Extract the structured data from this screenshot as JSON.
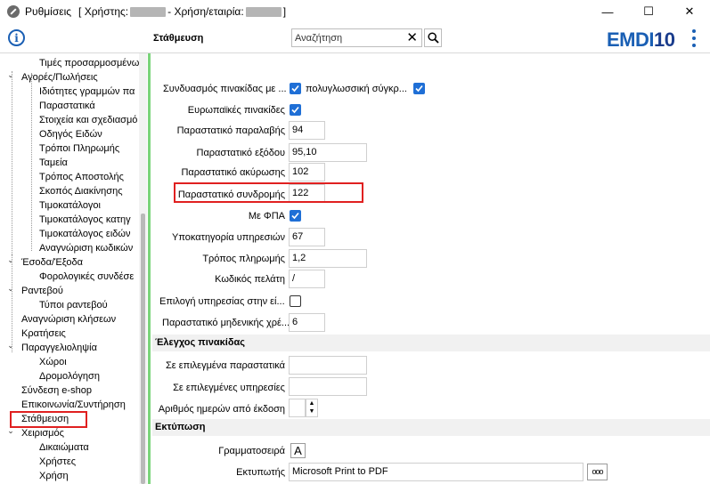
{
  "window": {
    "title_prefix": "Ρυθμίσεις",
    "title_user_label": "[ Χρήστης:",
    "title_company_label": "- Χρήση/εταιρία:",
    "title_suffix": "]",
    "minimize": "—",
    "maximize": "☐",
    "close": "✕"
  },
  "header": {
    "page_title": "Στάθμευση",
    "search_placeholder": "Αναζήτηση",
    "logo_part1": "EMDI",
    "logo_part2": "10",
    "info_glyph": "i"
  },
  "sidebar": {
    "items": [
      {
        "label": "Τιμές προσαρμοσμένω",
        "level": 2
      },
      {
        "label": "Αγορές/Πωλήσεις",
        "level": 1,
        "toggle": "⌄"
      },
      {
        "label": "Ιδιότητες γραμμών πα",
        "level": 2
      },
      {
        "label": "Παραστατικά",
        "level": 2
      },
      {
        "label": "Στοιχεία και σχεδιασμό",
        "level": 2
      },
      {
        "label": "Οδηγός Ειδών",
        "level": 2
      },
      {
        "label": "Τρόποι Πληρωμής",
        "level": 2
      },
      {
        "label": "Ταμεία",
        "level": 2
      },
      {
        "label": "Τρόπος Αποστολής",
        "level": 2
      },
      {
        "label": "Σκοπός Διακίνησης",
        "level": 2
      },
      {
        "label": "Τιμοκατάλογοι",
        "level": 2
      },
      {
        "label": "Τιμοκατάλογος κατηγ",
        "level": 2
      },
      {
        "label": "Τιμοκατάλογος ειδών",
        "level": 2
      },
      {
        "label": "Αναγνώριση κωδικών",
        "level": 2
      },
      {
        "label": "Έσοδα/Έξοδα",
        "level": 1,
        "toggle": "⌄"
      },
      {
        "label": "Φορολογικές συνδέσε",
        "level": 2
      },
      {
        "label": "Ραντεβού",
        "level": 1,
        "toggle": "⌄"
      },
      {
        "label": "Τύποι ραντεβού",
        "level": 2
      },
      {
        "label": "Αναγνώριση κλήσεων",
        "level": 1
      },
      {
        "label": "Κρατήσεις",
        "level": 1
      },
      {
        "label": "Παραγγελιοληψία",
        "level": 1,
        "toggle": "⌄"
      },
      {
        "label": "Χώροι",
        "level": 2
      },
      {
        "label": "Δρομολόγηση",
        "level": 2
      },
      {
        "label": "Σύνδεση e-shop",
        "level": 1
      },
      {
        "label": "Επικοινωνία/Συντήρηση",
        "level": 1
      },
      {
        "label": "Στάθμευση",
        "level": 1,
        "selected": true
      },
      {
        "label": "Χειρισμός",
        "level": 1,
        "toggle": "⌄"
      },
      {
        "label": "Δικαιώματα",
        "level": 2
      },
      {
        "label": "Χρήστες",
        "level": 2
      },
      {
        "label": "Χρήση",
        "level": 2
      }
    ]
  },
  "form": {
    "plate_combo_label": "Συνδυασμός πινακίδας με ...",
    "multilingual_label": "πολυγλωσσική σύγκρ...",
    "european_plates_label": "Ευρωπαϊκές πινακίδες",
    "receipt_doc_label": "Παραστατικό παραλαβής",
    "receipt_doc_value": "94",
    "exit_doc_label": "Παραστατικό εξόδου",
    "exit_doc_value": "95,10",
    "cancel_doc_label": "Παραστατικό ακύρωσης",
    "cancel_doc_value": "102",
    "subscription_doc_label": "Παραστατικό συνδρομής",
    "subscription_doc_value": "122",
    "vat_label": "Με ΦΠΑ",
    "service_subcat_label": "Υποκατηγορία υπηρεσιών",
    "service_subcat_value": "67",
    "payment_method_label": "Τρόπος πληρωμής",
    "payment_method_value": "1,2",
    "customer_code_label": "Κωδικός πελάτη",
    "customer_code_value": "/",
    "service_select_label": "Επιλογή υπηρεσίας στην εί...",
    "zero_doc_label": "Παραστατικό μηδενικής χρέ...",
    "zero_doc_value": "6",
    "plate_check_section": "Έλεγχος πινακίδας",
    "selected_docs_label": "Σε επιλεγμένα παραστατικά",
    "selected_services_label": "Σε επιλεγμένες υπηρεσίες",
    "days_from_issue_label": "Αριθμός ημερών από έκδοση",
    "print_section": "Εκτύπωση",
    "font_label": "Γραμματοσειρά",
    "font_button": "A",
    "printer_label": "Εκτυπωτής",
    "printer_value": "Microsoft Print to PDF",
    "printer_browse": "ooo"
  },
  "colors": {
    "accent": "#1f6fd6",
    "highlight": "#e02020",
    "divider": "#7ad47a"
  }
}
